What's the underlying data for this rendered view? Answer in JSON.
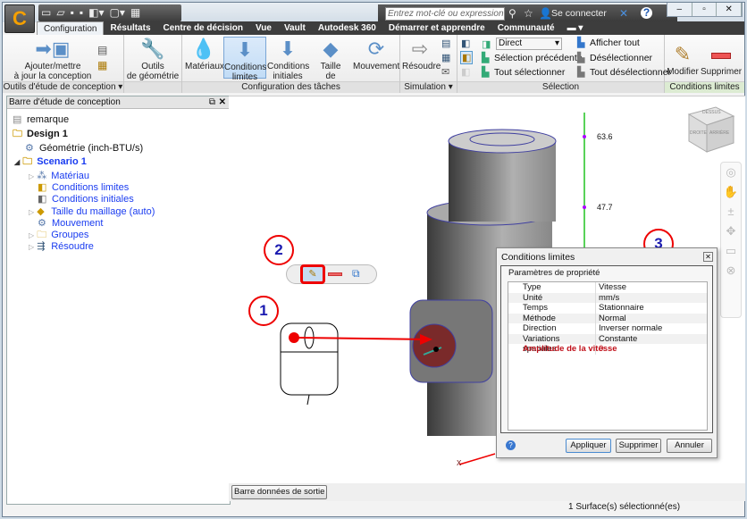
{
  "app": {
    "logo_letter": "C"
  },
  "quick_access": {
    "icons": [
      "new-icon",
      "open-icon",
      "save-icon",
      "save-as-icon",
      "view-icon",
      "cube-icon",
      "grid-icon"
    ]
  },
  "search": {
    "placeholder": "Entrez mot-clé ou expression"
  },
  "account": {
    "sign_in": "Se connecter"
  },
  "tabs": [
    "Configuration",
    "Résultats",
    "Centre de décision",
    "Vue",
    "Vault",
    "Autodesk 360",
    "Démarrer et apprendre",
    "Communauté"
  ],
  "active_tab": "Configuration",
  "ribbon": {
    "design_tools": {
      "label": "Outils d'étude de conception",
      "update_line1": "Ajouter/mettre",
      "update_line2": "à jour la conception"
    },
    "geometry": {
      "line1": "Outils",
      "line2": "de géométrie"
    },
    "task_setup": {
      "label": "Configuration des tâches",
      "materials": "Matériaux",
      "bc_line1": "Conditions",
      "bc_line2": "limites",
      "ic_line1": "Conditions",
      "ic_line2": "initiales",
      "mesh_line1": "Taille",
      "mesh_line2": "de maillage",
      "motion": "Mouvement"
    },
    "simulation": {
      "label": "Simulation",
      "solve": "Résoudre"
    },
    "selection": {
      "label": "Sélection",
      "mode": "Direct",
      "previous": "Sélection précédente",
      "select_all": "Tout sélectionner",
      "show_all": "Afficher tout",
      "deselect": "Désélectionner",
      "deselect_all": "Tout désélectionner"
    },
    "boundary": {
      "label": "Conditions limites",
      "edit": "Modifier",
      "delete": "Supprimer"
    }
  },
  "design_bar": {
    "title": "Barre d'étude de conception",
    "items": [
      {
        "label": "remarque"
      },
      {
        "label": "Design 1"
      },
      {
        "label": "Géométrie (inch-BTU/s)"
      },
      {
        "label": "Scenario 1"
      },
      {
        "label": "Matériau"
      },
      {
        "label": "Conditions limites"
      },
      {
        "label": "Conditions initiales"
      },
      {
        "label": "Taille du maillage (auto)"
      },
      {
        "label": "Mouvement"
      },
      {
        "label": "Groupes"
      },
      {
        "label": "Résoudre"
      }
    ]
  },
  "viewport": {
    "ruler_values": [
      "63.6",
      "47.7"
    ],
    "viewcube": {
      "top": "DESSUS",
      "front": "DROITE",
      "right": "ARRIÈRE"
    },
    "axis_label": "X",
    "callouts": [
      "1",
      "2",
      "3"
    ],
    "colors": {
      "selected_face": "#7a2a2a",
      "ruler": "#22c322",
      "callout": "#e00000"
    }
  },
  "dialog": {
    "title": "Conditions limites",
    "group": "Paramètres de propriété",
    "rows": [
      {
        "key": "Type",
        "value": "Vitesse"
      },
      {
        "key": "Unité",
        "value": "mm/s"
      },
      {
        "key": "Temps",
        "value": "Stationnaire"
      },
      {
        "key": "Méthode",
        "value": "Normal"
      },
      {
        "key": "Direction",
        "value": "Inverser normale"
      },
      {
        "key": "Variations spatiales",
        "value": "Constante"
      },
      {
        "key": "Amplitude de la vitesse",
        "value": "0"
      }
    ],
    "apply": "Appliquer",
    "delete": "Supprimer",
    "cancel": "Annuler"
  },
  "output_bar": "Barre données de sortie",
  "status": "1 Surface(s) sélectionné(es)"
}
